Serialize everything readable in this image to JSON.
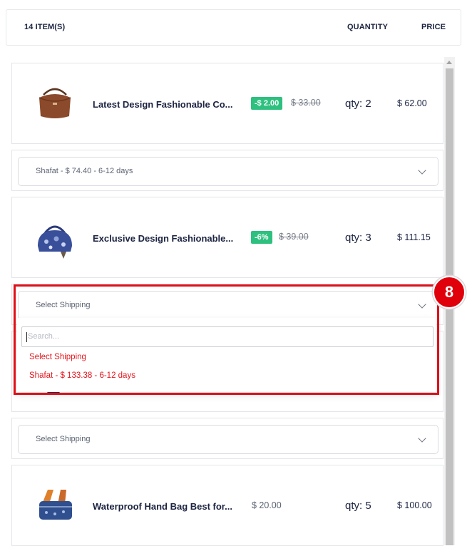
{
  "header": {
    "items_count": "14 ITEM(S)",
    "quantity_col": "QUANTITY",
    "price_col": "PRICE"
  },
  "products": [
    {
      "name": "Latest Design Fashionable Co...",
      "discount": "-$ 2.00",
      "original_price": "$ 33.00",
      "qty": "qty: 2",
      "total": "$ 62.00",
      "image": "brown-handbag"
    },
    {
      "name": "Exclusive Design Fashionable...",
      "discount": "-6%",
      "original_price": "$ 39.00",
      "qty": "qty: 3",
      "total": "$ 111.15",
      "image": "blue-floral-handbag"
    },
    {
      "name": "Waterproof Hand Bag Best for...",
      "price": "$ 20.00",
      "qty": "qty: 5",
      "total": "$ 100.00",
      "image": "blue-crossbody-bag"
    }
  ],
  "shipping": [
    {
      "selected": "Shafat - $ 74.40 - 6-12 days"
    },
    {
      "selected": "Select Shipping",
      "search_placeholder": "Search...",
      "options": [
        "Select Shipping",
        "Shafat - $ 133.38 - 6-12 days"
      ]
    },
    {
      "selected": "Select Shipping"
    }
  ],
  "callout": {
    "label": "8",
    "color": "#e0000c"
  },
  "colors": {
    "discount_badge": "#2ec07f",
    "option_text": "#e3161d",
    "highlight": "#e01018"
  }
}
